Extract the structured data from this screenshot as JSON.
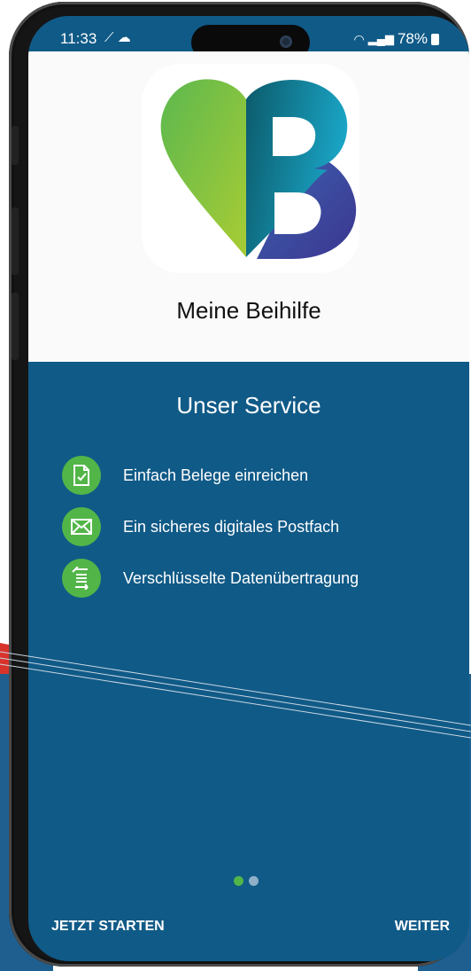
{
  "status_bar": {
    "time": "11:33",
    "left_icons": [
      "magic-wand-icon",
      "cloud-icon"
    ],
    "battery_percent": "78%",
    "right_icons": [
      "wifi-icon",
      "signal-icon",
      "battery-icon"
    ]
  },
  "app": {
    "name": "Meine Beihilfe",
    "logo_colors": {
      "heart_green": "#6ab84a",
      "b_teal": "#0f7a8f",
      "b_indigo": "#3a3f9a"
    }
  },
  "service": {
    "title": "Unser Service",
    "features": [
      {
        "icon": "document-check-icon",
        "label": "Einfach Belege einreichen"
      },
      {
        "icon": "envelope-icon",
        "label": "Ein sicheres digitales Postfach"
      },
      {
        "icon": "transfer-icon",
        "label": "Verschlüsselte Datenübertragung"
      }
    ]
  },
  "pagination": {
    "current": 1,
    "total": 2
  },
  "actions": {
    "start_label": "JETZT STARTEN",
    "next_label": "WEITER"
  },
  "colors": {
    "primary_blue": "#105a87",
    "accent_green": "#52b548"
  }
}
